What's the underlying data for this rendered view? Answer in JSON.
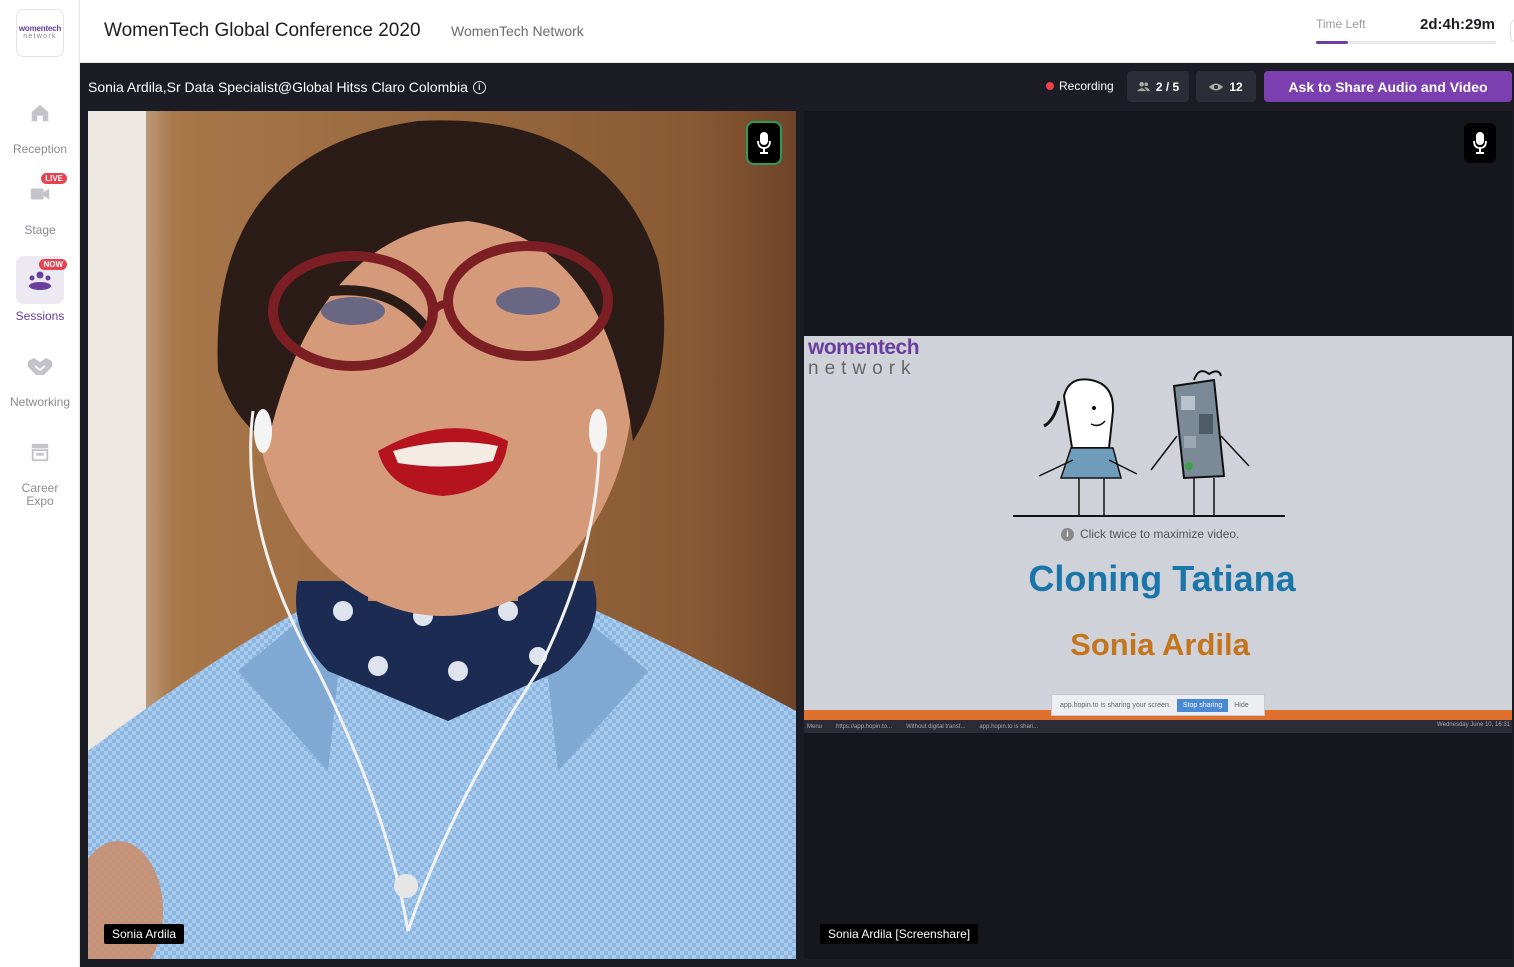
{
  "sidebar": {
    "logo": {
      "line1": "womentech",
      "line2": "network"
    },
    "items": [
      {
        "label": "Reception",
        "icon": "home-icon",
        "badge": null,
        "active": false
      },
      {
        "label": "Stage",
        "icon": "video-camera-icon",
        "badge": "LIVE",
        "active": false
      },
      {
        "label": "Sessions",
        "icon": "people-group-icon",
        "badge": "NOW",
        "active": true
      },
      {
        "label": "Networking",
        "icon": "handshake-icon",
        "badge": null,
        "active": false
      },
      {
        "label": "Career Expo",
        "icon": "booth-icon",
        "badge": null,
        "active": false
      }
    ]
  },
  "header": {
    "title": "WomenTech Global Conference 2020",
    "organization": "WomenTech Network",
    "time_left_label": "Time Left",
    "time_left_value": "2d:4h:29m",
    "time_progress": 0.18
  },
  "session": {
    "speaker_info": "Sonia Ardila,Sr Data Specialist@Global Hitss Claro Colombia",
    "recording_label": "Recording",
    "participants": "2 / 5",
    "viewers": "12",
    "share_button": "Ask to Share Audio and Video"
  },
  "tiles": {
    "camera": {
      "name": "Sonia Ardila"
    },
    "screenshare": {
      "name": "Sonia Ardila [Screenshare]"
    }
  },
  "slide": {
    "logo_line1": "womentech",
    "logo_line2": "network",
    "hint": "Click twice to maximize video.",
    "title": "Cloning Tatiana",
    "speaker": "Sonia Ardila",
    "share_notice": "app.hopin.to is sharing your screen.",
    "stop_sharing": "Stop sharing",
    "hide": "Hide",
    "taskbar_menu": "Menu",
    "taskbar_tabs": [
      "https://app.hopin.to...",
      "Without digital transf...",
      "app.hopin.to is shari..."
    ],
    "taskbar_date": "Wednesday June 10, 16:31"
  },
  "colors": {
    "accent": "#7c3fb0",
    "recording": "#ef3f47",
    "slide_title": "#1a75a8",
    "slide_speaker": "#c4741c"
  }
}
